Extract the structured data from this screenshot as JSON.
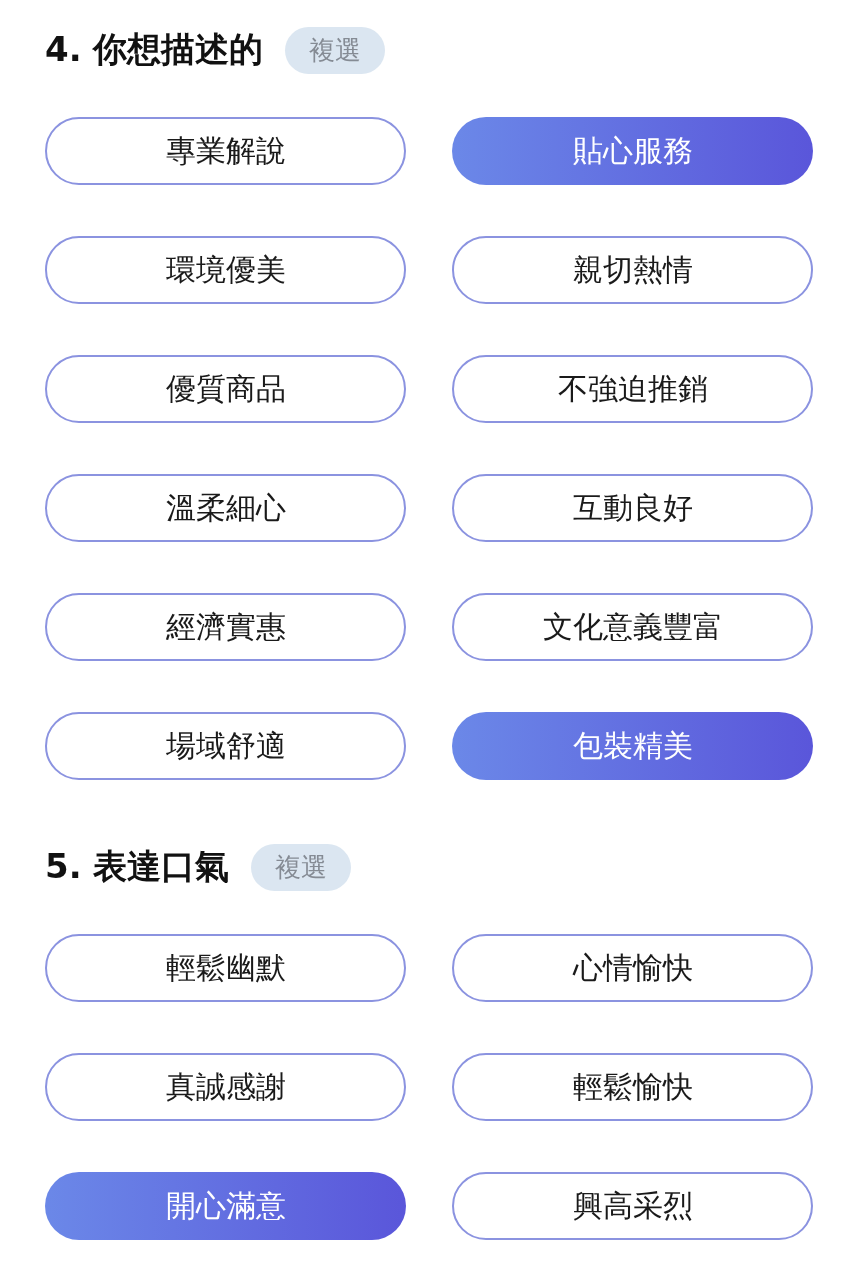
{
  "sections": [
    {
      "title": "4. 你想描述的",
      "badge": "複選",
      "options": [
        {
          "label": "專業解說",
          "selected": false
        },
        {
          "label": "貼心服務",
          "selected": true
        },
        {
          "label": "環境優美",
          "selected": false
        },
        {
          "label": "親切熱情",
          "selected": false
        },
        {
          "label": "優質商品",
          "selected": false
        },
        {
          "label": "不強迫推銷",
          "selected": false
        },
        {
          "label": "溫柔細心",
          "selected": false
        },
        {
          "label": "互動良好",
          "selected": false
        },
        {
          "label": "經濟實惠",
          "selected": false
        },
        {
          "label": "文化意義豐富",
          "selected": false
        },
        {
          "label": "場域舒適",
          "selected": false
        },
        {
          "label": "包裝精美",
          "selected": true
        }
      ]
    },
    {
      "title": "5. 表達口氣",
      "badge": "複選",
      "options": [
        {
          "label": "輕鬆幽默",
          "selected": false
        },
        {
          "label": "心情愉快",
          "selected": false
        },
        {
          "label": "真誠感謝",
          "selected": false
        },
        {
          "label": "輕鬆愉快",
          "selected": false
        },
        {
          "label": "開心滿意",
          "selected": true
        },
        {
          "label": "興高采烈",
          "selected": false
        }
      ]
    }
  ]
}
